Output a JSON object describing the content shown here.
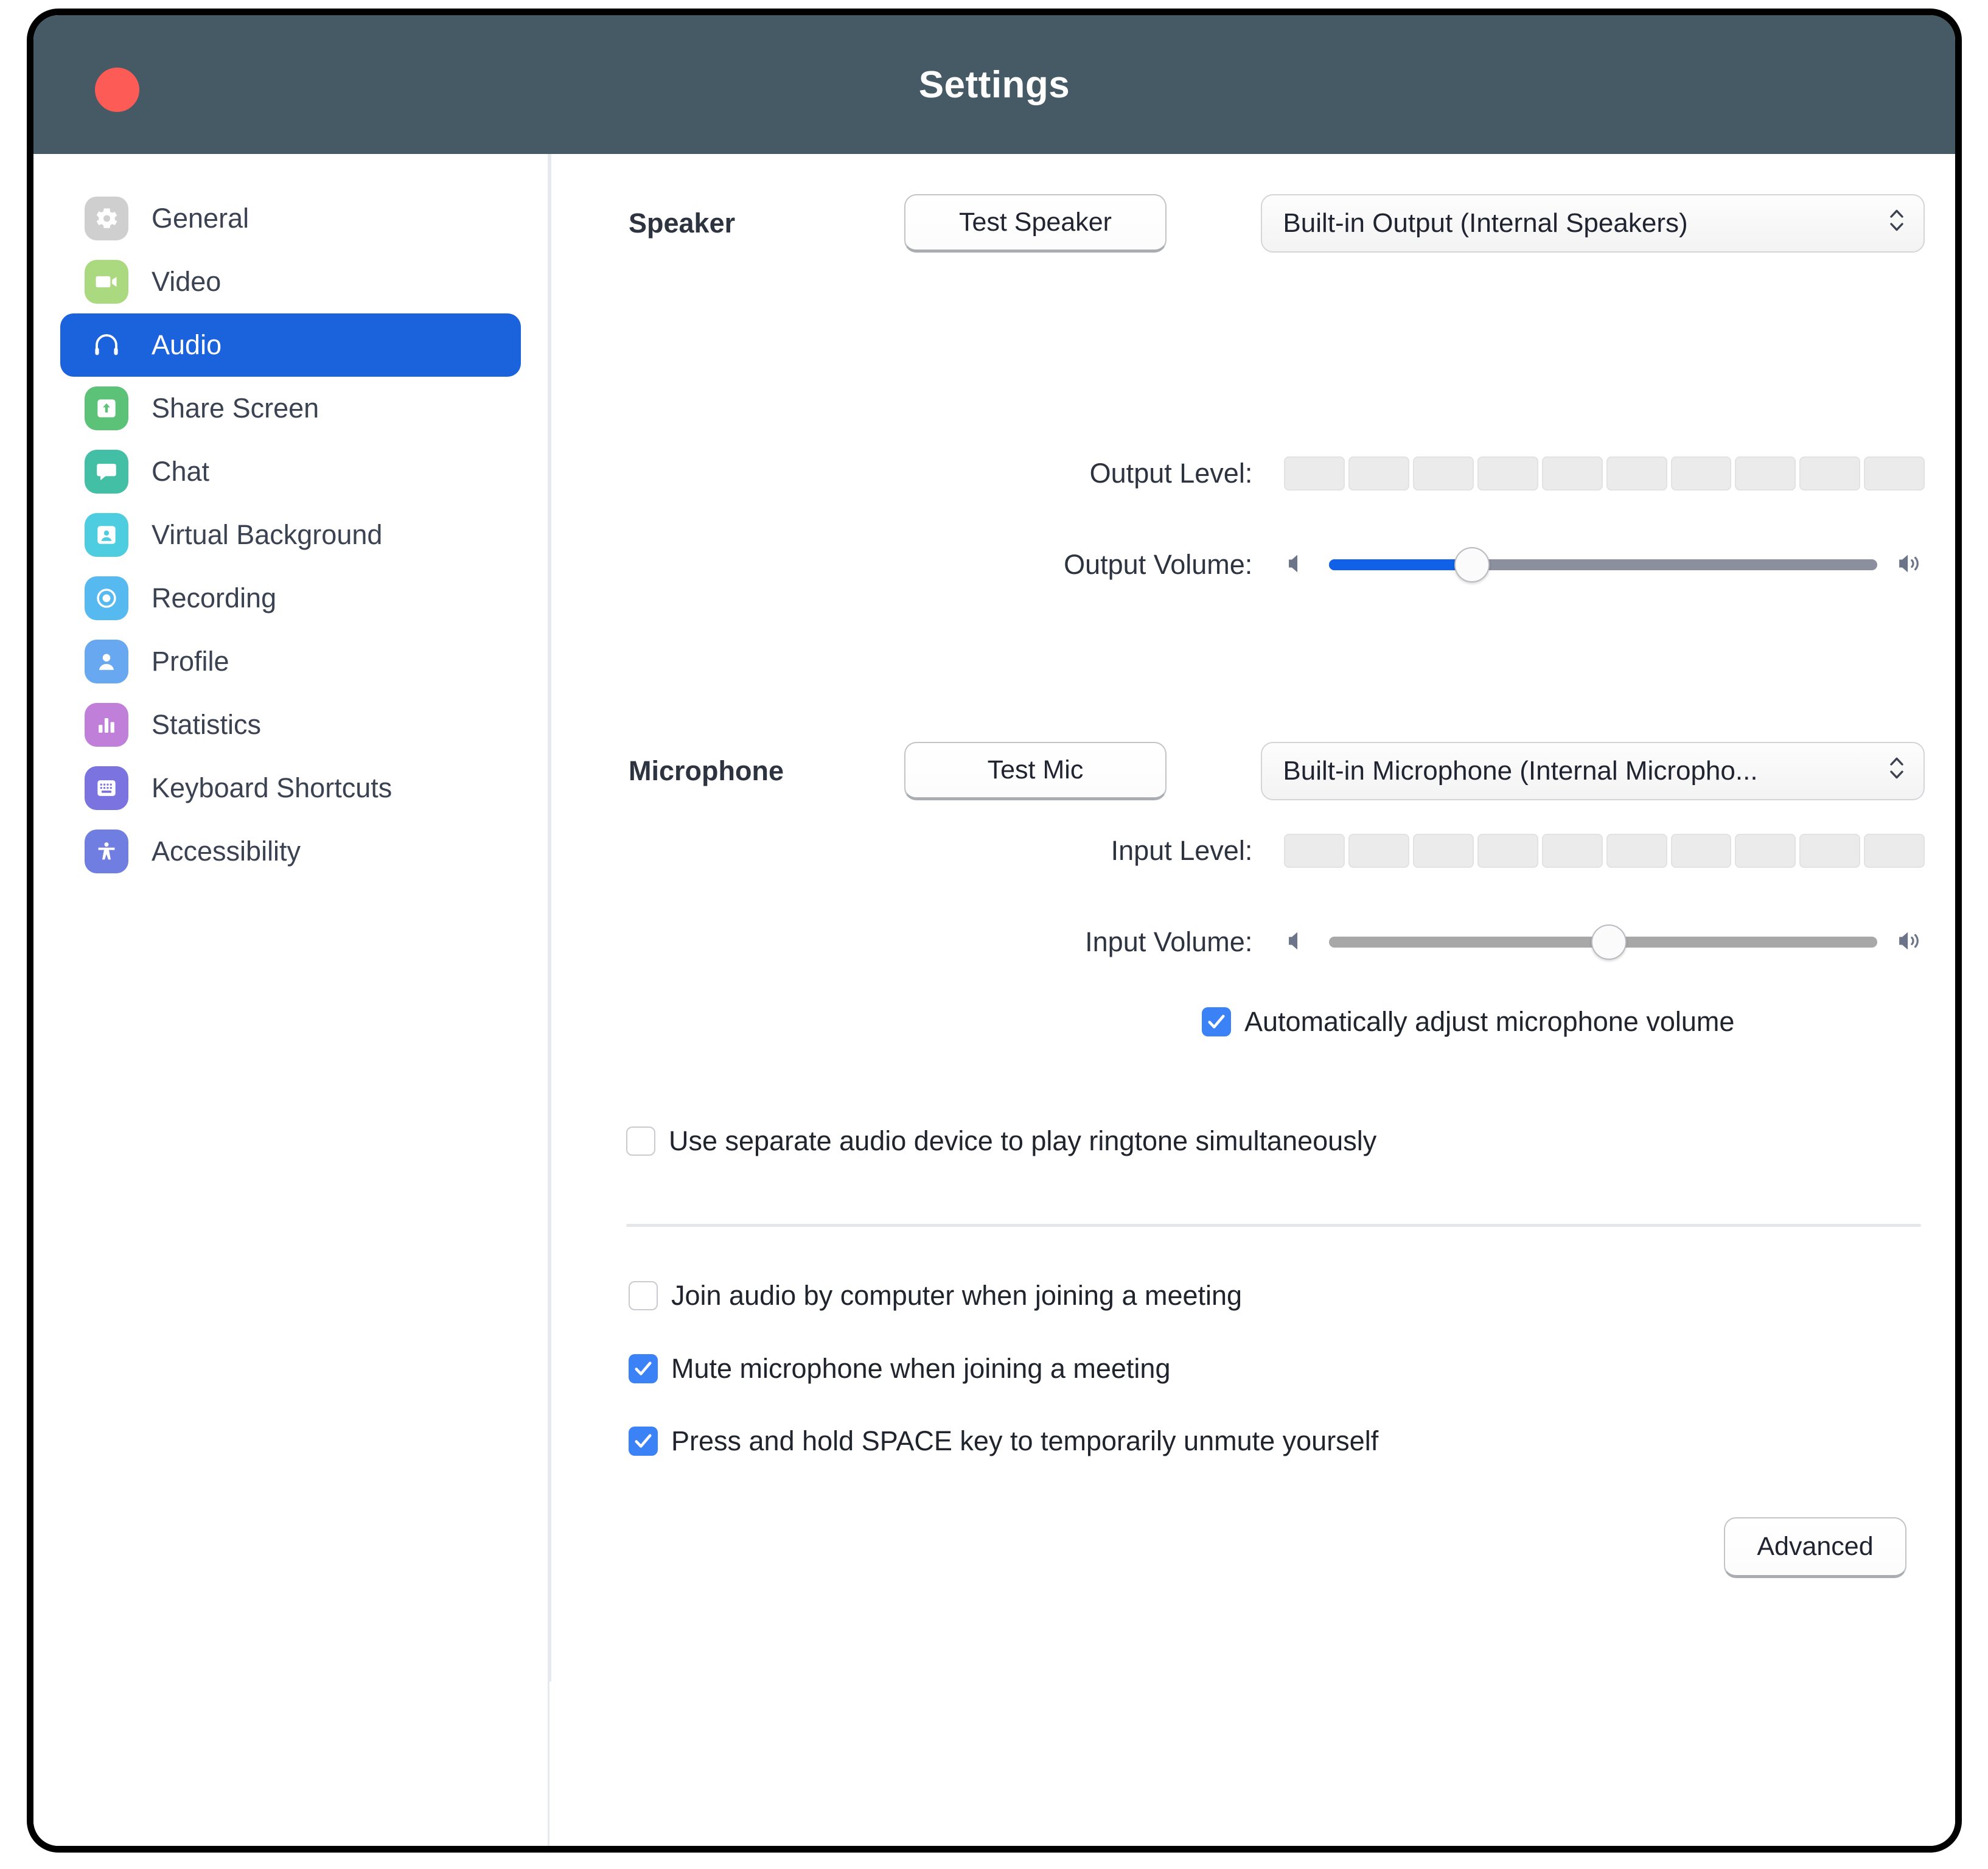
{
  "window": {
    "title": "Settings",
    "close_button": "close",
    "titlebar_color": "#455a64",
    "close_color": "#fc5b56"
  },
  "sidebar": {
    "active": "Audio",
    "active_color": "#1b63dd",
    "items": [
      {
        "label": "General",
        "icon": "gear-icon",
        "color": "#cfcfcf"
      },
      {
        "label": "Video",
        "icon": "video-camera-icon",
        "color": "#aad97f"
      },
      {
        "label": "Audio",
        "icon": "headphones-icon",
        "color": "#1b63dd"
      },
      {
        "label": "Share Screen",
        "icon": "share-screen-icon",
        "color": "#5cc278"
      },
      {
        "label": "Chat",
        "icon": "chat-bubble-icon",
        "color": "#43bfa6"
      },
      {
        "label": "Virtual Background",
        "icon": "virtual-background-icon",
        "color": "#4ecde0"
      },
      {
        "label": "Recording",
        "icon": "record-circle-icon",
        "color": "#56b9ef"
      },
      {
        "label": "Profile",
        "icon": "person-icon",
        "color": "#68a8f0"
      },
      {
        "label": "Statistics",
        "icon": "bar-chart-icon",
        "color": "#c07fd8"
      },
      {
        "label": "Keyboard Shortcuts",
        "icon": "keyboard-icon",
        "color": "#7a73e0"
      },
      {
        "label": "Accessibility",
        "icon": "accessibility-icon",
        "color": "#6f7ee0"
      }
    ]
  },
  "speaker": {
    "section_label": "Speaker",
    "test_button": "Test Speaker",
    "device": "Built-in Output (Internal Speakers)",
    "output_level_label": "Output Level:",
    "output_level_segments": 10,
    "output_level_active": 0,
    "output_volume_label": "Output Volume:",
    "output_volume_percent": 26,
    "mute_icon": "speaker-mute-icon",
    "loud_icon": "speaker-loud-icon",
    "fill_color": "#1060e8"
  },
  "microphone": {
    "section_label": "Microphone",
    "test_button": "Test Mic",
    "device": "Built-in Microphone (Internal Micropho...",
    "input_level_label": "Input Level:",
    "input_level_segments": 10,
    "input_level_active": 0,
    "input_volume_label": "Input Volume:",
    "input_volume_percent": 51,
    "mute_icon": "speaker-mute-icon",
    "loud_icon": "speaker-loud-icon",
    "auto_adjust": {
      "label": "Automatically adjust microphone volume",
      "checked": true
    }
  },
  "options": {
    "separate_ringtone": {
      "label": "Use separate audio device to play ringtone simultaneously",
      "checked": false
    },
    "join_audio": {
      "label": "Join audio by computer when joining a meeting",
      "checked": false
    },
    "mute_mic": {
      "label": "Mute microphone when joining a meeting",
      "checked": true
    },
    "space_unmute": {
      "label": "Press and hold SPACE key to temporarily unmute yourself",
      "checked": true
    }
  },
  "footer": {
    "advanced_button": "Advanced"
  }
}
